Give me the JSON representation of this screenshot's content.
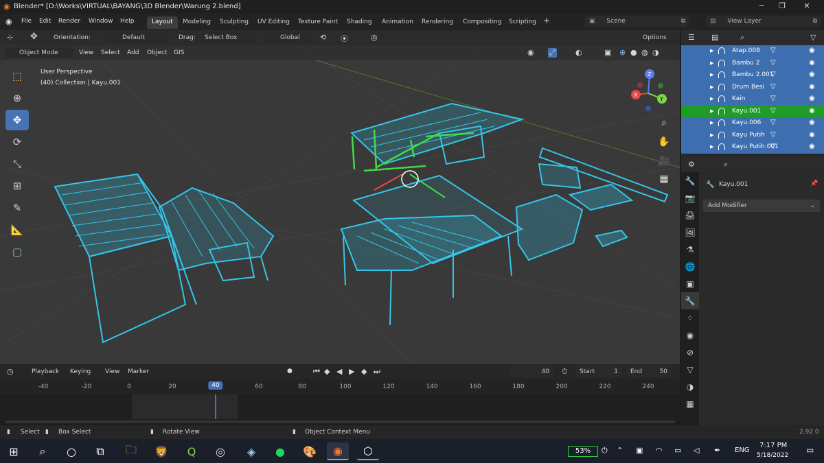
{
  "window": {
    "title": "Blender* [D:\\Works\\VIRTUAL\\BAYANG\\3D Blender\\Warung 2.blend]",
    "minimize": "─",
    "maximize": "❐",
    "close": "✕"
  },
  "menu": {
    "items": [
      "File",
      "Edit",
      "Render",
      "Window",
      "Help"
    ],
    "workspaces": [
      "Layout",
      "Modeling",
      "Sculpting",
      "UV Editing",
      "Texture Paint",
      "Shading",
      "Animation",
      "Rendering",
      "Compositing",
      "Scripting"
    ],
    "add_tab": "+",
    "scene": "Scene",
    "view_layer": "View Layer"
  },
  "viewport": {
    "orientation_label": "Orientation:",
    "orientation_value": "Default",
    "drag_label": "Drag:",
    "drag_value": "Select Box",
    "transform_orientation": "Global",
    "options": "Options",
    "mode": "Object Mode",
    "header_menus": [
      "View",
      "Select",
      "Add",
      "Object",
      "GIS"
    ],
    "overlay_text_1": "User Perspective",
    "overlay_text_2": "(40) Collection | Kayu.001",
    "gizmo": {
      "x": "X",
      "y": "Y",
      "z": "Z"
    }
  },
  "timeline": {
    "menus": [
      "Playback",
      "Keying",
      "View",
      "Marker"
    ],
    "current_frame": "40",
    "start_label": "Start",
    "start": "1",
    "end_label": "End",
    "end": "50",
    "ruler": [
      "-40",
      "-20",
      "0",
      "20",
      "40",
      "60",
      "80",
      "100",
      "120",
      "140",
      "160",
      "180",
      "200",
      "220",
      "240"
    ],
    "current_marker": "40"
  },
  "status": {
    "select": "Select",
    "box_select": "Box Select",
    "rotate_view": "Rotate View",
    "context_menu": "Object Context Menu",
    "version": "2.92.0"
  },
  "outliner": {
    "rows": [
      {
        "name": "Atap.008",
        "active": false
      },
      {
        "name": "Bambu 2",
        "active": false
      },
      {
        "name": "Bambu 2.001",
        "active": false
      },
      {
        "name": "Drum Besi",
        "active": false
      },
      {
        "name": "Kain",
        "active": false
      },
      {
        "name": "Kayu.001",
        "active": true
      },
      {
        "name": "Kayu.006",
        "active": false
      },
      {
        "name": "Kayu Putih",
        "active": false
      },
      {
        "name": "Kayu Putih.001",
        "active": false
      }
    ]
  },
  "properties": {
    "object_name": "Kayu.001",
    "add_modifier": "Add Modifier"
  },
  "taskbar": {
    "battery": "53%",
    "lang": "ENG",
    "time": "7:17 PM",
    "date": "5/18/2022"
  },
  "colors": {
    "accent": "#4772b3",
    "selected_row": "#1f9c27",
    "wire": "#33c6ea"
  }
}
